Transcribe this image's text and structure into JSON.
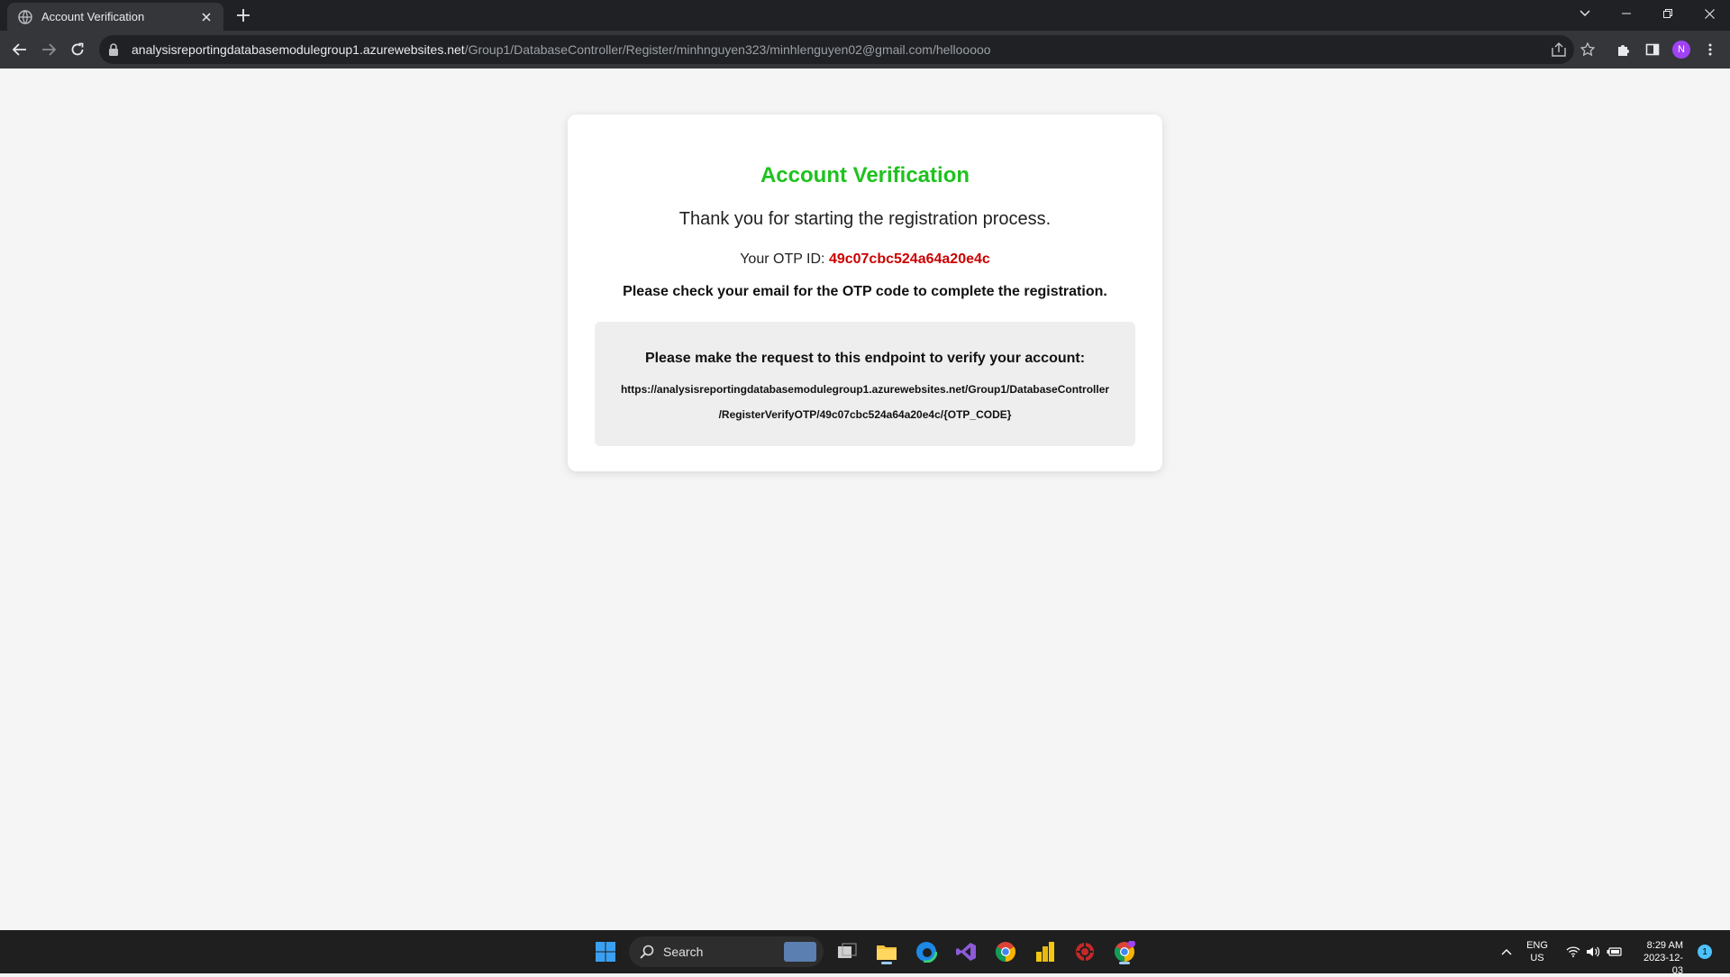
{
  "browser": {
    "tab_title": "Account Verification",
    "url_host": "analysisreportingdatabasemodulegroup1.azurewebsites.net",
    "url_path": "/Group1/DatabaseController/Register/minhnguyen323/minhlenguyen02@gmail.com/hellooooo",
    "profile_initial": "N"
  },
  "page": {
    "heading": "Account Verification",
    "thanks_text": "Thank you for starting the registration process.",
    "otp_label": "Your OTP ID: ",
    "otp_id": "49c07cbc524a64a20e4c",
    "check_email_text": "Please check your email for the OTP code to complete the registration.",
    "endpoint_heading": "Please make the request to this endpoint to verify your account:",
    "endpoint_line1": "https://analysisreportingdatabasemodulegroup1.azurewebsites.net/Group1/DatabaseController",
    "endpoint_line2": "/RegisterVerifyOTP/49c07cbc524a64a20e4c/{OTP_CODE}"
  },
  "taskbar": {
    "search_label": "Search",
    "lang_line1": "ENG",
    "lang_line2": "US",
    "time": "8:29 AM",
    "date": "2023-12-03",
    "notification_count": "1"
  },
  "colors": {
    "heading": "#1ec21e",
    "otp": "#cc0000"
  }
}
